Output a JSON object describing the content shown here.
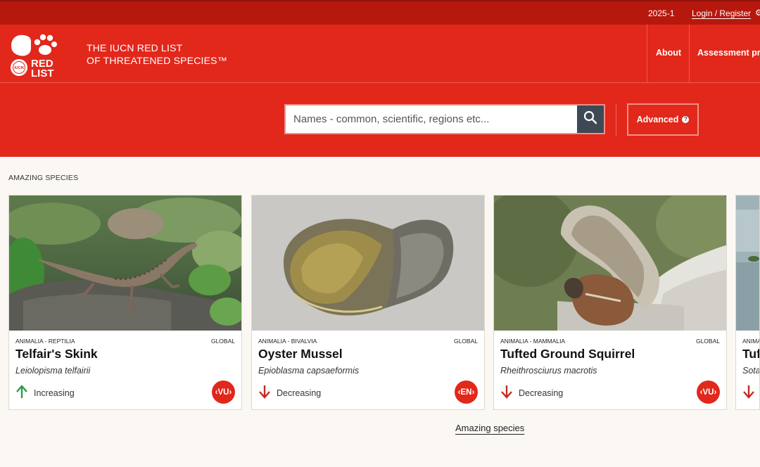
{
  "topbar": {
    "version": "2025-1",
    "login": "Login / Register"
  },
  "header": {
    "tagline_line1": "THE IUCN RED LIST",
    "tagline_line2": "OF THREATENED SPECIES™",
    "logo_text_1": "RED",
    "logo_text_2": "LIST",
    "logo_badge": "IUCN",
    "nav": [
      {
        "label": "About"
      },
      {
        "label": "Assessment pr"
      }
    ]
  },
  "search": {
    "placeholder": "Names - common, scientific, regions etc...",
    "advanced_label": "Advanced",
    "advanced_help": "?"
  },
  "section": {
    "label": "AMAZING SPECIES"
  },
  "cards": [
    {
      "taxon": "ANIMALIA - REPTILIA",
      "scope": "GLOBAL",
      "common_name": "Telfair's Skink",
      "scientific_name": "Leiolopisma telfairii",
      "trend": "Increasing",
      "status": "VU"
    },
    {
      "taxon": "ANIMALIA - BIVALVIA",
      "scope": "GLOBAL",
      "common_name": "Oyster Mussel",
      "scientific_name": "Epioblasma capsaeformis",
      "trend": "Decreasing",
      "status": "EN"
    },
    {
      "taxon": "ANIMALIA - MAMMALIA",
      "scope": "GLOBAL",
      "common_name": "Tufted Ground Squirrel",
      "scientific_name": "Rheithrosciurus macrotis",
      "trend": "Decreasing",
      "status": "VU"
    },
    {
      "taxon": "ANIMA",
      "scope": "",
      "common_name": "Tuf",
      "scientific_name": "Sota",
      "trend": "",
      "status": ""
    }
  ],
  "footer_link": "Amazing species",
  "colors": {
    "brand_red": "#e2271b",
    "dark_red": "#b6180d",
    "increasing": "#2e9a4a",
    "decreasing": "#c62a1e"
  },
  "icons": {
    "search": "search-icon",
    "increasing": "arrow-up-icon",
    "decreasing": "arrow-down-icon"
  }
}
